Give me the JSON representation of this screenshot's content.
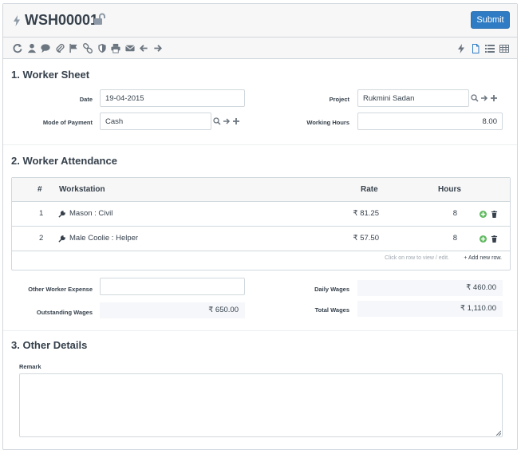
{
  "header": {
    "title": "WSH00001",
    "submit_label": "Submit"
  },
  "toolbar": {
    "icons": [
      "refresh-icon",
      "user-icon",
      "comment-icon",
      "paperclip-icon",
      "flag-icon",
      "link-icon",
      "shield-icon",
      "print-icon",
      "email-icon",
      "arrow-left-icon",
      "arrow-right-icon"
    ],
    "view_icons": [
      "bolt-icon",
      "file-icon",
      "list-icon",
      "table-icon"
    ]
  },
  "worker_sheet": {
    "title": "1. Worker Sheet",
    "date_label": "Date",
    "date_value": "19-04-2015",
    "project_label": "Project",
    "project_value": "Rukmini Sadan",
    "payment_label": "Mode of Payment",
    "payment_value": "Cash",
    "hours_label": "Working Hours",
    "hours_value": "8.00"
  },
  "attendance": {
    "title": "2. Worker Attendance",
    "columns": {
      "num": "#",
      "workstation": "Workstation",
      "rate": "Rate",
      "hours": "Hours"
    },
    "rows": [
      {
        "num": "1",
        "workstation": "Mason : Civil",
        "rate": "₹ 81.25",
        "hours": "8"
      },
      {
        "num": "2",
        "workstation": "Male Coolie : Helper",
        "rate": "₹ 57.50",
        "hours": "8"
      }
    ],
    "hint": "Click on row to view / edit.",
    "add_row": "+ Add new row.",
    "other_expense_label": "Other Worker Expense",
    "other_expense_value": "",
    "outstanding_label": "Outstanding Wages",
    "outstanding_value": "₹ 650.00",
    "daily_label": "Daily Wages",
    "daily_value": "₹ 460.00",
    "total_label": "Total Wages",
    "total_value": "₹ 1,110.00"
  },
  "other": {
    "title": "3. Other Details",
    "remark_label": "Remark",
    "remark_value": ""
  },
  "colors": {
    "accent": "#2f7cc4",
    "border": "#d1d8dd",
    "text": "#36414c",
    "green": "#5cb85c"
  }
}
